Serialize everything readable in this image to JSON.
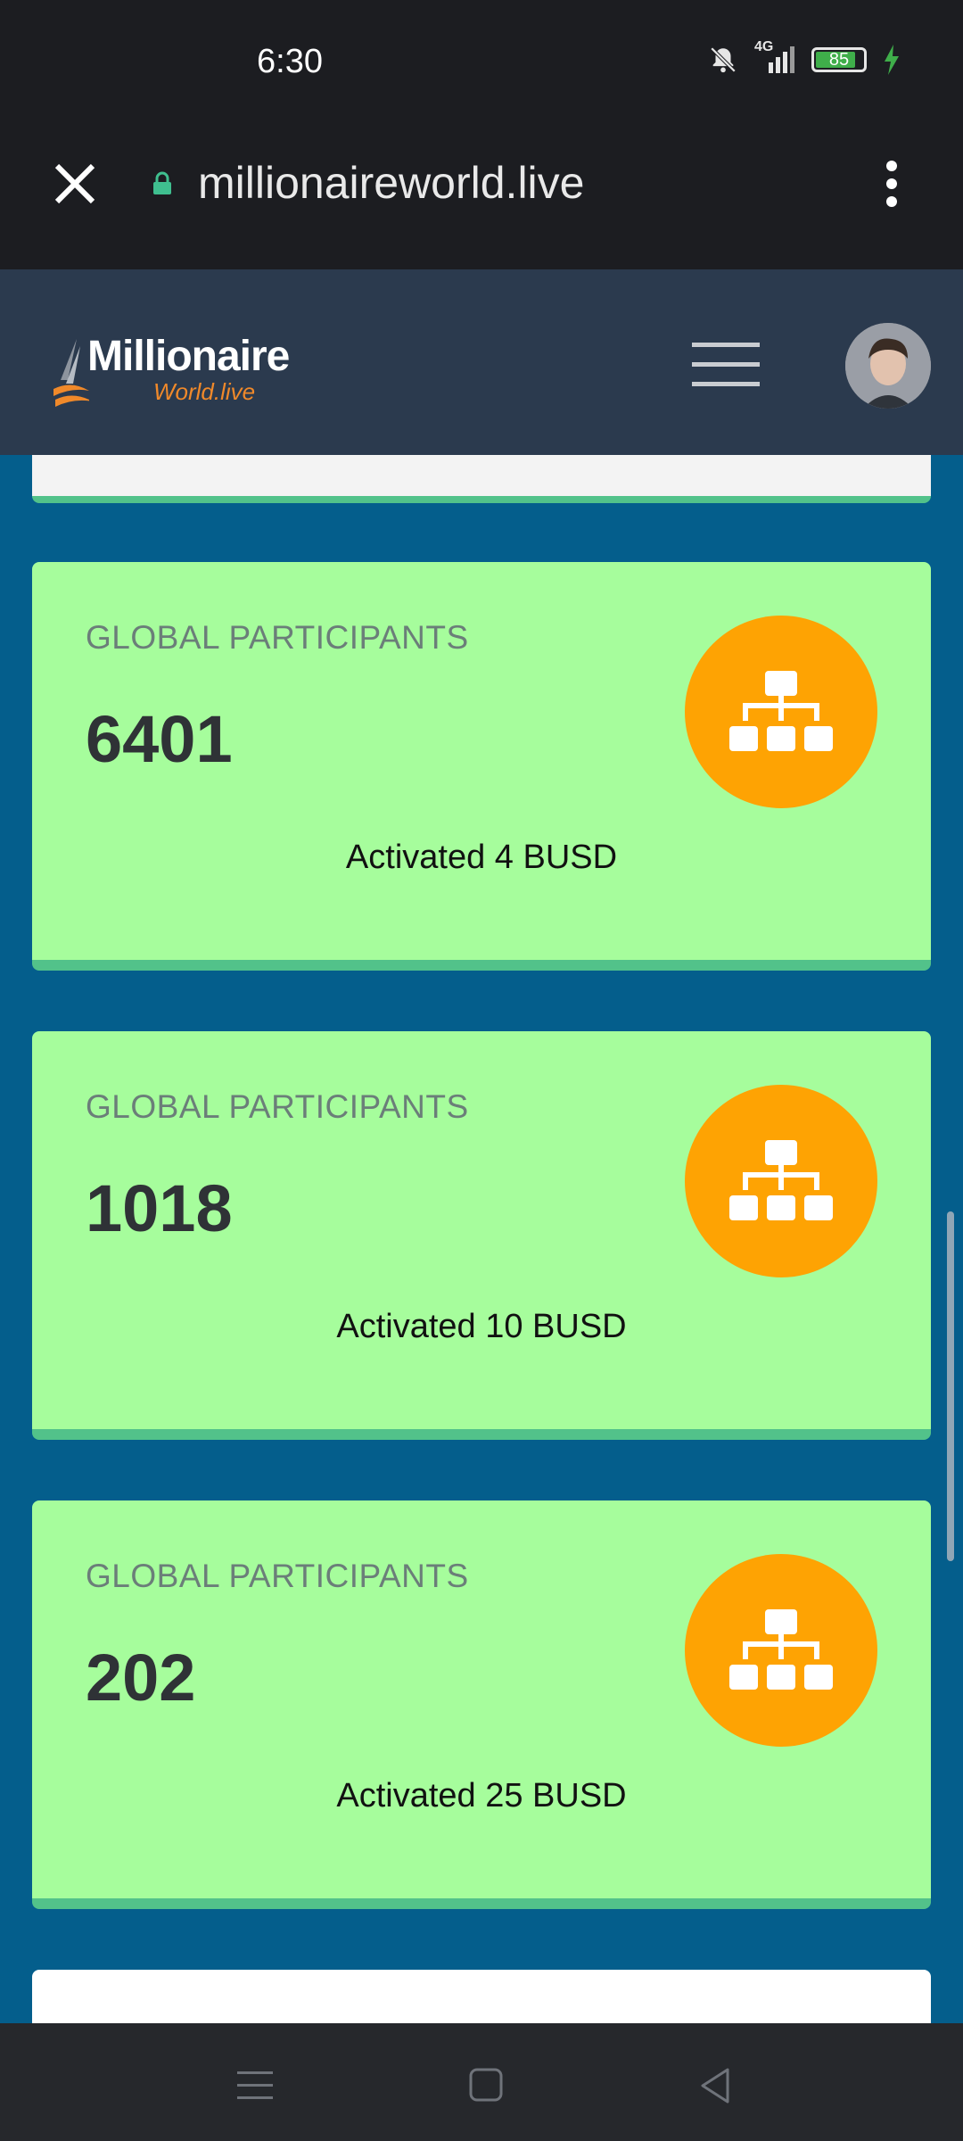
{
  "status_bar": {
    "time": "6:30",
    "network": "4G",
    "battery": "85",
    "battery_level": 0.85
  },
  "browser": {
    "url": "millionaireworld.live"
  },
  "header": {
    "logo_main": "Millionaire",
    "logo_sub": "World.live"
  },
  "cards": [
    {
      "title": "GLOBAL PARTICIPANTS",
      "value": "6401",
      "subtitle": "Activated 4 BUSD",
      "icon": "sitemap-icon"
    },
    {
      "title": "GLOBAL PARTICIPANTS",
      "value": "1018",
      "subtitle": "Activated 10 BUSD",
      "icon": "sitemap-icon"
    },
    {
      "title": "GLOBAL PARTICIPANTS",
      "value": "202",
      "subtitle": "Activated 25 BUSD",
      "icon": "sitemap-icon"
    }
  ],
  "colors": {
    "card_bg": "#a6fd9c",
    "card_border": "#52c28a",
    "icon_circle": "#fea303",
    "page_bg": "#045e8c",
    "header_bg": "#2b3a4e"
  }
}
